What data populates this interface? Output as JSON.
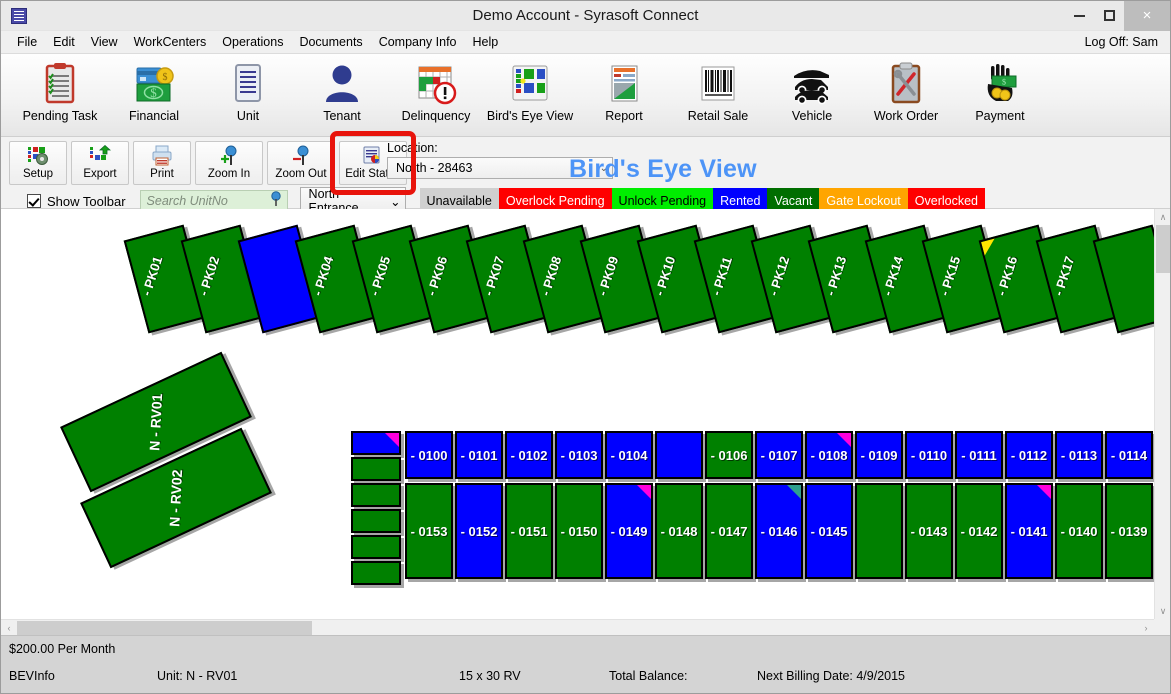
{
  "window": {
    "title": "Demo Account - Syrasoft Connect",
    "app_icon": "document-window-icon",
    "minimize": "–",
    "maximize": "□",
    "close": "×"
  },
  "menubar": {
    "items": [
      {
        "label": "File"
      },
      {
        "label": "Edit"
      },
      {
        "label": "View"
      },
      {
        "label": "WorkCenters"
      },
      {
        "label": "Operations"
      },
      {
        "label": "Documents"
      },
      {
        "label": "Company Info"
      },
      {
        "label": "Help"
      }
    ],
    "logoff": "Log Off: Sam"
  },
  "ribbon": {
    "buttons": [
      {
        "label": "Pending Task",
        "icon": "clipboard-checklist-icon"
      },
      {
        "label": "Financial",
        "icon": "money-card-icon"
      },
      {
        "label": "Unit",
        "icon": "lined-document-icon"
      },
      {
        "label": "Tenant",
        "icon": "person-icon"
      },
      {
        "label": "Delinquency",
        "icon": "calendar-alert-icon"
      },
      {
        "label": "Bird's Eye View",
        "icon": "site-map-icon"
      },
      {
        "label": "Report",
        "icon": "report-chart-icon"
      },
      {
        "label": "Retail Sale",
        "icon": "barcode-icon"
      },
      {
        "label": "Vehicle",
        "icon": "vehicle-icon"
      },
      {
        "label": "Work Order",
        "icon": "wrench-clipboard-icon"
      },
      {
        "label": "Payment",
        "icon": "hand-cash-icon"
      }
    ]
  },
  "bev_toolbar": {
    "buttons": [
      {
        "label": "Setup",
        "icon": "setup-gear-icon"
      },
      {
        "label": "Export",
        "icon": "export-arrow-icon"
      },
      {
        "label": "Print",
        "icon": "printer-icon"
      },
      {
        "label": "Zoom In",
        "icon": "zoom-in-icon"
      },
      {
        "label": "Zoom Out",
        "icon": "zoom-out-icon"
      },
      {
        "label": "Edit Status",
        "icon": "edit-status-icon"
      }
    ],
    "highlight_color": "#e8140c",
    "location_label": "Location:",
    "location_value": "North - 28463",
    "show_toolbar_label": "Show Toolbar",
    "show_toolbar_checked": true,
    "search_placeholder": "Search UnitNo",
    "search_value": "",
    "entrance_value": "North Entrance",
    "chevron": "⌄",
    "page_title": "Bird's Eye View",
    "page_title_color": "#4d94f7"
  },
  "legend": [
    {
      "label": "Unavailable",
      "bg": "#d0d0d0",
      "fg": "#000000"
    },
    {
      "label": "Overlock Pending",
      "bg": "#ff0000",
      "fg": "#ffffff"
    },
    {
      "label": "Unlock Pending",
      "bg": "#00ee00",
      "fg": "#000000"
    },
    {
      "label": "Rented",
      "bg": "#0000ff",
      "fg": "#ffffff"
    },
    {
      "label": "Vacant",
      "bg": "#006e00",
      "fg": "#ffffff"
    },
    {
      "label": "Gate Lockout",
      "bg": "#ffa500",
      "fg": "#ffffff"
    },
    {
      "label": "Overlocked",
      "bg": "#ff0000",
      "fg": "#ffffff"
    }
  ],
  "map": {
    "colors": {
      "vacant": "#008000",
      "rented": "#0000ff",
      "marker_yellow": "#ffe500",
      "marker_magenta": "#ff00dd",
      "marker_cyan": "#00c8ff"
    },
    "parking_row": {
      "rotation_deg": -15,
      "units": [
        {
          "label": "- PK01",
          "status": "vacant"
        },
        {
          "label": "- PK02",
          "status": "vacant"
        },
        {
          "label": "",
          "status": "rented"
        },
        {
          "label": "- PK04",
          "status": "vacant"
        },
        {
          "label": "- PK05",
          "status": "vacant"
        },
        {
          "label": "- PK06",
          "status": "vacant"
        },
        {
          "label": "- PK07",
          "status": "vacant"
        },
        {
          "label": "- PK08",
          "status": "vacant"
        },
        {
          "label": "- PK09",
          "status": "vacant"
        },
        {
          "label": "- PK10",
          "status": "vacant"
        },
        {
          "label": "- PK11",
          "status": "vacant"
        },
        {
          "label": "- PK12",
          "status": "vacant"
        },
        {
          "label": "- PK13",
          "status": "vacant"
        },
        {
          "label": "- PK14",
          "status": "vacant"
        },
        {
          "label": "- PK15",
          "status": "vacant"
        },
        {
          "label": "- PK16",
          "status": "vacant",
          "marker": "yellow-tl"
        },
        {
          "label": "- PK17",
          "status": "vacant"
        },
        {
          "label": "",
          "status": "vacant"
        }
      ]
    },
    "rv_units": [
      {
        "label": "N - RV01",
        "status": "vacant"
      },
      {
        "label": "N - RV02",
        "status": "vacant"
      }
    ],
    "small_column": [
      {
        "label": "",
        "status": "rented",
        "marker": "magenta-tr"
      },
      {
        "label": "",
        "status": "vacant"
      },
      {
        "label": "",
        "status": "vacant"
      },
      {
        "label": "",
        "status": "vacant"
      },
      {
        "label": "",
        "status": "vacant"
      },
      {
        "label": "",
        "status": "vacant"
      }
    ],
    "grid_row_1": [
      {
        "label": "- 0100",
        "status": "rented"
      },
      {
        "label": "- 0101",
        "status": "rented"
      },
      {
        "label": "- 0102",
        "status": "rented"
      },
      {
        "label": "- 0103",
        "status": "rented"
      },
      {
        "label": "- 0104",
        "status": "rented"
      },
      {
        "label": "",
        "status": "rented"
      },
      {
        "label": "- 0106",
        "status": "vacant"
      },
      {
        "label": "- 0107",
        "status": "rented"
      },
      {
        "label": "- 0108",
        "status": "rented",
        "marker": "magenta-tr"
      },
      {
        "label": "- 0109",
        "status": "rented"
      },
      {
        "label": "- 0110",
        "status": "rented"
      },
      {
        "label": "- 0111",
        "status": "rented"
      },
      {
        "label": "- 0112",
        "status": "rented"
      },
      {
        "label": "- 0113",
        "status": "rented"
      },
      {
        "label": "- 0114",
        "status": "rented"
      }
    ],
    "grid_row_2": [
      {
        "label": "- 0153",
        "status": "vacant"
      },
      {
        "label": "- 0152",
        "status": "rented"
      },
      {
        "label": "- 0151",
        "status": "vacant"
      },
      {
        "label": "- 0150",
        "status": "vacant"
      },
      {
        "label": "- 0149",
        "status": "rented",
        "marker": "magenta-tr"
      },
      {
        "label": "- 0148",
        "status": "vacant"
      },
      {
        "label": "- 0147",
        "status": "vacant"
      },
      {
        "label": "- 0146",
        "status": "rented",
        "marker": "teal-tr"
      },
      {
        "label": "- 0145",
        "status": "rented"
      },
      {
        "label": "",
        "status": "vacant"
      },
      {
        "label": "- 0143",
        "status": "vacant"
      },
      {
        "label": "- 0142",
        "status": "vacant"
      },
      {
        "label": "- 0141",
        "status": "rented",
        "marker": "magenta-tr"
      },
      {
        "label": "- 0140",
        "status": "vacant"
      },
      {
        "label": "- 0139",
        "status": "vacant"
      }
    ]
  },
  "scrollbars": {
    "up_arrow": "∧",
    "down_arrow": "∨",
    "left_arrow": "‹",
    "right_arrow": "›"
  },
  "statusbar": {
    "rate": "$200.00 Per Month",
    "info_label": "BEVInfo",
    "unit": "Unit: N - RV01",
    "size": "15 x 30 RV",
    "total_balance": "Total Balance:",
    "next_billing": "Next Billing Date: 4/9/2015"
  }
}
